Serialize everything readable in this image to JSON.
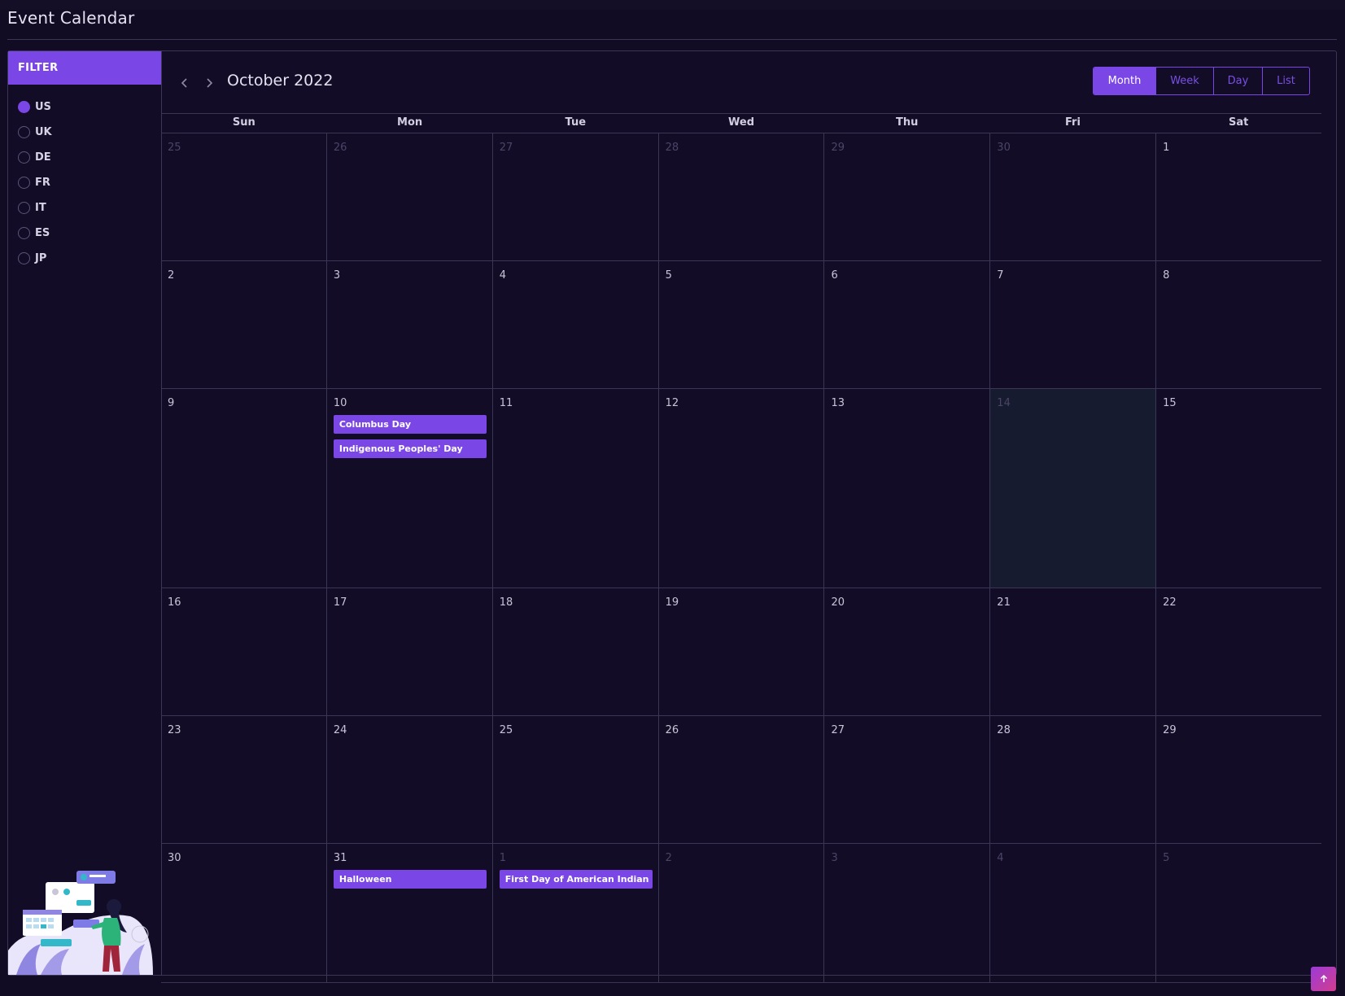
{
  "page": {
    "title": "Event Calendar"
  },
  "filter": {
    "heading": "FILTER",
    "options": [
      {
        "label": "US",
        "checked": true
      },
      {
        "label": "UK",
        "checked": false
      },
      {
        "label": "DE",
        "checked": false
      },
      {
        "label": "FR",
        "checked": false
      },
      {
        "label": "IT",
        "checked": false
      },
      {
        "label": "ES",
        "checked": false
      },
      {
        "label": "JP",
        "checked": false
      }
    ]
  },
  "calendar": {
    "title": "October 2022",
    "prev_icon": "chevron-left-icon",
    "next_icon": "chevron-right-icon",
    "views": [
      "Month",
      "Week",
      "Day",
      "List"
    ],
    "active_view": "Month",
    "weekdays": [
      "Sun",
      "Mon",
      "Tue",
      "Wed",
      "Thu",
      "Fri",
      "Sat"
    ],
    "weeks": [
      [
        {
          "d": "25",
          "other": true
        },
        {
          "d": "26",
          "other": true
        },
        {
          "d": "27",
          "other": true
        },
        {
          "d": "28",
          "other": true
        },
        {
          "d": "29",
          "other": true
        },
        {
          "d": "30",
          "other": true
        },
        {
          "d": "1"
        }
      ],
      [
        {
          "d": "2"
        },
        {
          "d": "3"
        },
        {
          "d": "4"
        },
        {
          "d": "5"
        },
        {
          "d": "6"
        },
        {
          "d": "7"
        },
        {
          "d": "8"
        }
      ],
      [
        {
          "d": "9"
        },
        {
          "d": "10",
          "events": [
            "Columbus Day",
            "Indigenous Peoples' Day"
          ]
        },
        {
          "d": "11"
        },
        {
          "d": "12"
        },
        {
          "d": "13"
        },
        {
          "d": "14",
          "today": true
        },
        {
          "d": "15"
        }
      ],
      [
        {
          "d": "16"
        },
        {
          "d": "17"
        },
        {
          "d": "18"
        },
        {
          "d": "19"
        },
        {
          "d": "20"
        },
        {
          "d": "21"
        },
        {
          "d": "22"
        }
      ],
      [
        {
          "d": "23"
        },
        {
          "d": "24"
        },
        {
          "d": "25"
        },
        {
          "d": "26"
        },
        {
          "d": "27"
        },
        {
          "d": "28"
        },
        {
          "d": "29"
        }
      ],
      [
        {
          "d": "30"
        },
        {
          "d": "31",
          "events": [
            "Halloween"
          ]
        },
        {
          "d": "1",
          "other": true,
          "events": [
            "First Day of American Indian Heri"
          ]
        },
        {
          "d": "2",
          "other": true
        },
        {
          "d": "3",
          "other": true
        },
        {
          "d": "4",
          "other": true
        },
        {
          "d": "5",
          "other": true
        }
      ]
    ]
  },
  "colors": {
    "accent": "#7a46e6",
    "background": "#120b24",
    "border": "#3b3556",
    "today": "#171b2f"
  },
  "scroll_top_icon": "arrow-up-icon"
}
